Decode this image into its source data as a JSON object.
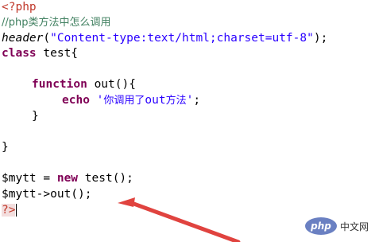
{
  "code": {
    "open_tag": "<?php",
    "comment": "//php类方法中怎么调用",
    "header_fn": "header",
    "header_open": "(",
    "header_string": "\"Content-type:text/html;charset=utf-8\"",
    "header_close": ");",
    "class_kw": "class",
    "class_name": " test{",
    "function_kw": "function",
    "function_sig": " out(){",
    "echo_kw": "echo",
    "echo_string_quote_open": "'",
    "echo_string_cn1": "你调用了",
    "echo_string_out": "out",
    "echo_string_cn2": "方法",
    "echo_string_quote_close": "'",
    "echo_end": ";",
    "inner_close": "}",
    "outer_close": "}",
    "assign_lhs": "$mytt = ",
    "new_kw": "new",
    "assign_rhs": " test();",
    "call": "$mytt->out();",
    "close_tag": "?>"
  },
  "watermark": {
    "logo_text": "php",
    "site_text": "中文网"
  },
  "colors": {
    "php_tag": "#c0392b",
    "comment": "#3f7f5f",
    "string": "#2a00ff",
    "keyword": "#7f0055",
    "arrow": "#e0433f",
    "watermark_oval": "#6a80c2"
  }
}
